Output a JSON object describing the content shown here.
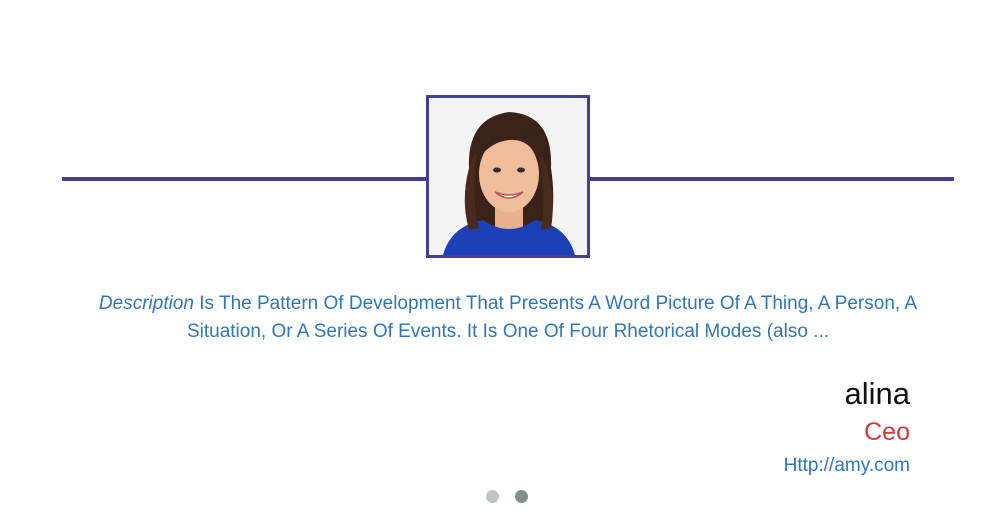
{
  "testimonial": {
    "description_lead": "Description",
    "description_rest": " Is The Pattern Of Development That Presents A Word Picture Of A Thing, A Person, A Situation, Or A Series Of Events. It Is One Of Four Rhetorical Modes (also ...",
    "name": "alina",
    "role": "Ceo",
    "website": "Http://amy.com"
  },
  "carousel": {
    "active_index": 1,
    "count": 2
  },
  "colors": {
    "accent": "#453f93",
    "text_blue": "#2f76b6",
    "role_red": "#d33a35"
  }
}
